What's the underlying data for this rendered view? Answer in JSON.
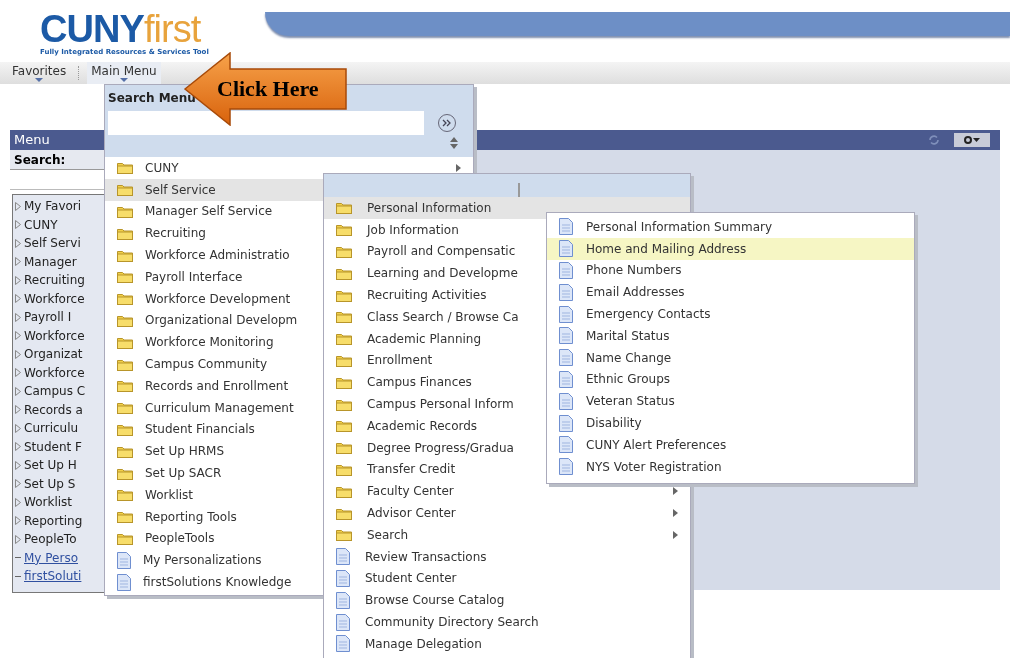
{
  "logo": {
    "primary": "CUNY",
    "secondary": "first",
    "tagline": "Fully Integrated Resources & Services Tool"
  },
  "nav": [
    {
      "label": "Favorites",
      "selected": false
    },
    {
      "label": "Main Menu",
      "selected": true
    }
  ],
  "callout": {
    "text": "Click Here"
  },
  "menu_panel": {
    "title": "Menu",
    "search_label": "Search:",
    "items": [
      {
        "label": "My Favori",
        "kind": "folder"
      },
      {
        "label": "CUNY",
        "kind": "folder"
      },
      {
        "label": "Self Servi",
        "kind": "folder"
      },
      {
        "label": "Manager",
        "kind": "folder"
      },
      {
        "label": "Recruiting",
        "kind": "folder"
      },
      {
        "label": "Workforce",
        "kind": "folder"
      },
      {
        "label": "Payroll I",
        "kind": "folder"
      },
      {
        "label": "Workforce",
        "kind": "folder"
      },
      {
        "label": "Organizat",
        "kind": "folder"
      },
      {
        "label": "Workforce",
        "kind": "folder"
      },
      {
        "label": "Campus C",
        "kind": "folder"
      },
      {
        "label": "Records a",
        "kind": "folder"
      },
      {
        "label": "Curriculu",
        "kind": "folder"
      },
      {
        "label": "Student F",
        "kind": "folder"
      },
      {
        "label": "Set Up H",
        "kind": "folder"
      },
      {
        "label": "Set Up S",
        "kind": "folder"
      },
      {
        "label": "Worklist",
        "kind": "folder"
      },
      {
        "label": "Reporting",
        "kind": "folder"
      },
      {
        "label": "PeopleTo",
        "kind": "folder"
      },
      {
        "label": "My Perso",
        "kind": "link"
      },
      {
        "label": "firstSoluti",
        "kind": "link"
      }
    ]
  },
  "main_menu": {
    "search_label": "Search Menu",
    "items": [
      {
        "label": "CUNY",
        "kind": "folder",
        "arrow": true,
        "selected": false
      },
      {
        "label": "Self Service",
        "kind": "folder",
        "arrow": false,
        "selected": true
      },
      {
        "label": "Manager Self Service",
        "kind": "folder",
        "arrow": false,
        "selected": false
      },
      {
        "label": "Recruiting",
        "kind": "folder",
        "arrow": false,
        "selected": false
      },
      {
        "label": "Workforce Administratio",
        "kind": "folder",
        "arrow": false,
        "selected": false
      },
      {
        "label": "Payroll Interface",
        "kind": "folder",
        "arrow": false,
        "selected": false
      },
      {
        "label": "Workforce Development",
        "kind": "folder",
        "arrow": false,
        "selected": false
      },
      {
        "label": "Organizational Developm",
        "kind": "folder",
        "arrow": false,
        "selected": false
      },
      {
        "label": "Workforce Monitoring",
        "kind": "folder",
        "arrow": false,
        "selected": false
      },
      {
        "label": "Campus Community",
        "kind": "folder",
        "arrow": false,
        "selected": false
      },
      {
        "label": "Records and Enrollment",
        "kind": "folder",
        "arrow": false,
        "selected": false
      },
      {
        "label": "Curriculum Management",
        "kind": "folder",
        "arrow": false,
        "selected": false
      },
      {
        "label": "Student Financials",
        "kind": "folder",
        "arrow": false,
        "selected": false
      },
      {
        "label": "Set Up HRMS",
        "kind": "folder",
        "arrow": false,
        "selected": false
      },
      {
        "label": "Set Up SACR",
        "kind": "folder",
        "arrow": false,
        "selected": false
      },
      {
        "label": "Worklist",
        "kind": "folder",
        "arrow": false,
        "selected": false
      },
      {
        "label": "Reporting Tools",
        "kind": "folder",
        "arrow": false,
        "selected": false
      },
      {
        "label": "PeopleTools",
        "kind": "folder",
        "arrow": false,
        "selected": false
      },
      {
        "label": "My Personalizations",
        "kind": "page",
        "arrow": false,
        "selected": false
      },
      {
        "label": "firstSolutions Knowledge",
        "kind": "page",
        "arrow": false,
        "selected": false
      }
    ]
  },
  "self_service_menu": {
    "items": [
      {
        "label": "Personal Information",
        "kind": "folder",
        "arrow": false,
        "selected": true
      },
      {
        "label": "Job Information",
        "kind": "folder",
        "arrow": false,
        "selected": false
      },
      {
        "label": "Payroll and Compensatic",
        "kind": "folder",
        "arrow": false,
        "selected": false
      },
      {
        "label": "Learning and Developme",
        "kind": "folder",
        "arrow": false,
        "selected": false
      },
      {
        "label": "Recruiting Activities",
        "kind": "folder",
        "arrow": false,
        "selected": false
      },
      {
        "label": "Class Search / Browse Ca",
        "kind": "folder",
        "arrow": false,
        "selected": false
      },
      {
        "label": "Academic Planning",
        "kind": "folder",
        "arrow": false,
        "selected": false
      },
      {
        "label": "Enrollment",
        "kind": "folder",
        "arrow": false,
        "selected": false
      },
      {
        "label": "Campus Finances",
        "kind": "folder",
        "arrow": false,
        "selected": false
      },
      {
        "label": "Campus Personal Inform",
        "kind": "folder",
        "arrow": false,
        "selected": false
      },
      {
        "label": "Academic Records",
        "kind": "folder",
        "arrow": false,
        "selected": false
      },
      {
        "label": "Degree Progress/Gradua",
        "kind": "folder",
        "arrow": false,
        "selected": false
      },
      {
        "label": "Transfer Credit",
        "kind": "folder",
        "arrow": false,
        "selected": false
      },
      {
        "label": "Faculty Center",
        "kind": "folder",
        "arrow": true,
        "selected": false
      },
      {
        "label": "Advisor Center",
        "kind": "folder",
        "arrow": true,
        "selected": false
      },
      {
        "label": "Search",
        "kind": "folder",
        "arrow": true,
        "selected": false
      },
      {
        "label": "Review Transactions",
        "kind": "page",
        "arrow": false,
        "selected": false
      },
      {
        "label": "Student Center",
        "kind": "page",
        "arrow": false,
        "selected": false
      },
      {
        "label": "Browse Course Catalog",
        "kind": "page",
        "arrow": false,
        "selected": false
      },
      {
        "label": "Community Directory Search",
        "kind": "page",
        "arrow": false,
        "selected": false
      },
      {
        "label": "Manage Delegation",
        "kind": "page",
        "arrow": false,
        "selected": false
      }
    ]
  },
  "personal_information_menu": {
    "items": [
      {
        "label": "Personal Information Summary",
        "kind": "page",
        "arrow": false,
        "selected": false
      },
      {
        "label": "Home and Mailing Address",
        "kind": "page",
        "arrow": false,
        "selected": true
      },
      {
        "label": "Phone Numbers",
        "kind": "page",
        "arrow": false,
        "selected": false
      },
      {
        "label": "Email Addresses",
        "kind": "page",
        "arrow": false,
        "selected": false
      },
      {
        "label": "Emergency Contacts",
        "kind": "page",
        "arrow": false,
        "selected": false
      },
      {
        "label": "Marital Status",
        "kind": "page",
        "arrow": false,
        "selected": false
      },
      {
        "label": "Name Change",
        "kind": "page",
        "arrow": false,
        "selected": false
      },
      {
        "label": "Ethnic Groups",
        "kind": "page",
        "arrow": false,
        "selected": false
      },
      {
        "label": "Veteran Status",
        "kind": "page",
        "arrow": false,
        "selected": false
      },
      {
        "label": "Disability",
        "kind": "page",
        "arrow": false,
        "selected": false
      },
      {
        "label": "CUNY Alert Preferences",
        "kind": "page",
        "arrow": false,
        "selected": false
      },
      {
        "label": "NYS Voter Registration",
        "kind": "page",
        "arrow": false,
        "selected": false
      }
    ]
  }
}
